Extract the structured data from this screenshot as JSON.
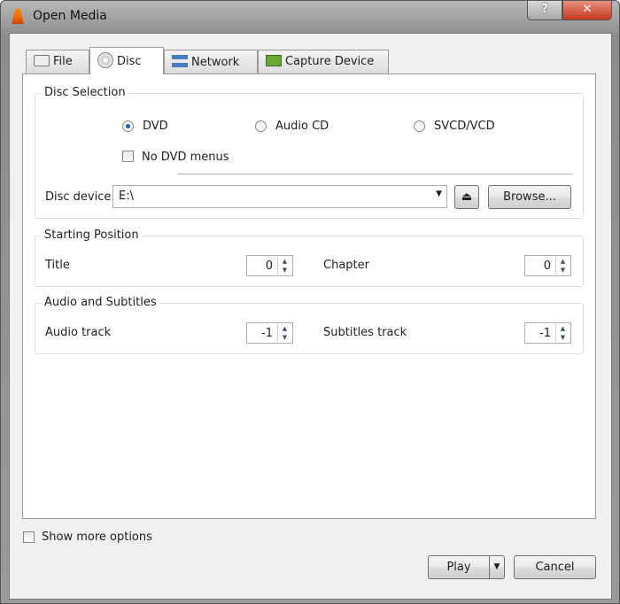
{
  "window": {
    "title": "Open Media",
    "help": "?",
    "close": "✕"
  },
  "tabs": [
    {
      "label": "File",
      "icon": "folder-icon"
    },
    {
      "label": "Disc",
      "icon": "disc-icon"
    },
    {
      "label": "Network",
      "icon": "network-icon"
    },
    {
      "label": "Capture Device",
      "icon": "capture-card-icon"
    }
  ],
  "active_tab": "Disc",
  "disc_selection": {
    "label": "Disc Selection",
    "options": [
      "DVD",
      "Audio CD",
      "SVCD/VCD"
    ],
    "selected": "DVD",
    "no_menus_label": "No DVD menus",
    "no_menus_checked": false,
    "device_label": "Disc device",
    "device_value": "E:\\",
    "browse_label": "Browse..."
  },
  "starting_position": {
    "label": "Starting Position",
    "title_label": "Title",
    "title_value": "0",
    "chapter_label": "Chapter",
    "chapter_value": "0"
  },
  "audio_subtitles": {
    "label": "Audio and Subtitles",
    "audio_label": "Audio track",
    "audio_value": "-1",
    "subtitles_label": "Subtitles track",
    "subtitles_value": "-1"
  },
  "footer": {
    "show_more_label": "Show more options",
    "show_more_checked": false,
    "play_label": "Play",
    "cancel_label": "Cancel"
  }
}
